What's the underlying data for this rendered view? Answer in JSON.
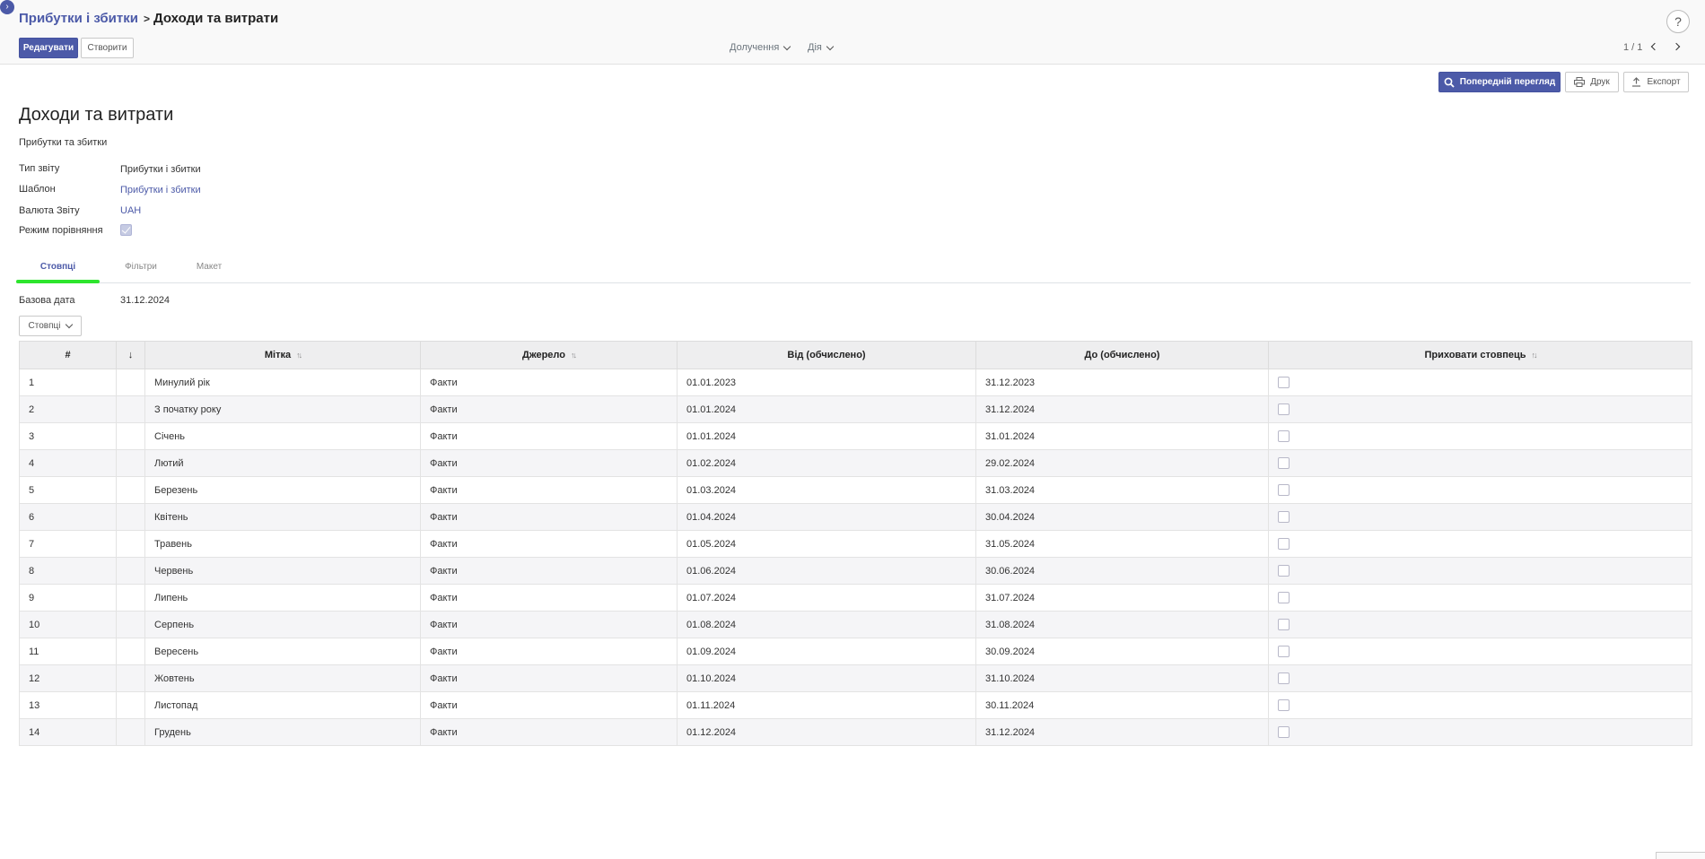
{
  "breadcrumb": {
    "parent": "Прибутки і збитки",
    "separator": ">",
    "current": "Доходи та витрати"
  },
  "help": "?",
  "toolbar": {
    "edit_label": "Редагувати",
    "create_label": "Створити",
    "attachments_label": "Долучення",
    "action_label": "Дія",
    "pager": "1 / 1"
  },
  "report_actions": {
    "preview_label": "Попередній перегляд",
    "print_label": "Друк",
    "export_label": "Експорт"
  },
  "sheet": {
    "title": "Доходи та витрати",
    "subtitle": "Прибутки та збитки",
    "fields": {
      "report_type": {
        "label": "Тип звіту",
        "value": "Прибутки і збитки"
      },
      "template": {
        "label": "Шаблон",
        "value": "Прибутки і збитки"
      },
      "currency": {
        "label": "Валюта Звіту",
        "value": "UAH"
      },
      "comparison_mode": {
        "label": "Режим порівняння",
        "value": true
      }
    }
  },
  "tabs": {
    "columns": "Стовпці",
    "filters": "Фільтри",
    "layout": "Макет"
  },
  "base_date": {
    "label": "Базова дата",
    "value": "31.12.2024"
  },
  "columns_button": "Стовпці",
  "table": {
    "headers": {
      "num": "#",
      "order": "↓",
      "label": "Мітка",
      "source": "Джерело",
      "from": "Від (обчислено)",
      "to": "До (обчислено)",
      "hide": "Приховати стовпець"
    },
    "rows": [
      {
        "num": "1",
        "label": "Минулий рік",
        "source": "Факти",
        "from": "01.01.2023",
        "to": "31.12.2023",
        "hidden": false
      },
      {
        "num": "2",
        "label": "З початку року",
        "source": "Факти",
        "from": "01.01.2024",
        "to": "31.12.2024",
        "hidden": false
      },
      {
        "num": "3",
        "label": "Січень",
        "source": "Факти",
        "from": "01.01.2024",
        "to": "31.01.2024",
        "hidden": false
      },
      {
        "num": "4",
        "label": "Лютий",
        "source": "Факти",
        "from": "01.02.2024",
        "to": "29.02.2024",
        "hidden": false
      },
      {
        "num": "5",
        "label": "Березень",
        "source": "Факти",
        "from": "01.03.2024",
        "to": "31.03.2024",
        "hidden": false
      },
      {
        "num": "6",
        "label": "Квітень",
        "source": "Факти",
        "from": "01.04.2024",
        "to": "30.04.2024",
        "hidden": false
      },
      {
        "num": "7",
        "label": "Травень",
        "source": "Факти",
        "from": "01.05.2024",
        "to": "31.05.2024",
        "hidden": false
      },
      {
        "num": "8",
        "label": "Червень",
        "source": "Факти",
        "from": "01.06.2024",
        "to": "30.06.2024",
        "hidden": false
      },
      {
        "num": "9",
        "label": "Липень",
        "source": "Факти",
        "from": "01.07.2024",
        "to": "31.07.2024",
        "hidden": false
      },
      {
        "num": "10",
        "label": "Серпень",
        "source": "Факти",
        "from": "01.08.2024",
        "to": "31.08.2024",
        "hidden": false
      },
      {
        "num": "11",
        "label": "Вересень",
        "source": "Факти",
        "from": "01.09.2024",
        "to": "30.09.2024",
        "hidden": false
      },
      {
        "num": "12",
        "label": "Жовтень",
        "source": "Факти",
        "from": "01.10.2024",
        "to": "31.10.2024",
        "hidden": false
      },
      {
        "num": "13",
        "label": "Листопад",
        "source": "Факти",
        "from": "01.11.2024",
        "to": "30.11.2024",
        "hidden": false
      },
      {
        "num": "14",
        "label": "Грудень",
        "source": "Факти",
        "from": "01.12.2024",
        "to": "31.12.2024",
        "hidden": false
      }
    ]
  },
  "colors": {
    "primary": "#4c5aa8",
    "tab_underline": "#2ee52e",
    "header_bg": "#eeeeef",
    "stripe": "#f5f5f7"
  },
  "icons": {
    "corner": "chevron-right-icon",
    "preview": "search-icon",
    "print": "printer-icon",
    "export": "upload-icon"
  }
}
